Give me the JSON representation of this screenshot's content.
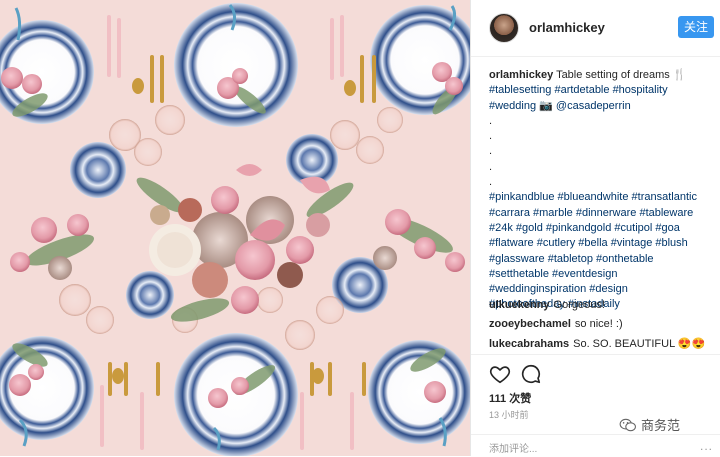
{
  "post": {
    "username": "orlamhickey",
    "follow_label": "关注"
  },
  "caption": {
    "username": "orlamhickey",
    "text": "Table setting of dreams 🍴",
    "tags_line1": [
      "#tablesetting",
      "#artdetable",
      "#hospitality"
    ],
    "tag_wedding": "#wedding",
    "camera_icon": "📷",
    "mention": "@casadeperrin",
    "dots": [
      ".",
      ".",
      ".",
      ".",
      "."
    ],
    "hashtags": [
      "#pinkandblue",
      "#blueandwhite",
      "#transatlantic",
      "#carrara",
      "#marble",
      "#dinnerware",
      "#tableware",
      "#24k",
      "#gold",
      "#pinkandgold",
      "#cutipol",
      "#goa",
      "#flatware",
      "#cutlery",
      "#bella",
      "#vintage",
      "#blush",
      "#glassware",
      "#tabletop",
      "#onthetable",
      "#setthetable",
      "#eventdesign",
      "#weddinginspiration",
      "#design",
      "#photooftheday",
      "#instadaily"
    ]
  },
  "comments": [
    {
      "user": "ulkuekenny",
      "text": "Gorgeous!"
    },
    {
      "user": "zooeybechamel",
      "text": "so nice! :)"
    },
    {
      "user": "lukecabrahams",
      "text": "So. SO. BEAUTIFUL 😍😍"
    }
  ],
  "stats": {
    "likes": "111 次赞",
    "time": "13 小时前"
  },
  "watermark": "商务范",
  "add_comment": {
    "placeholder": "添加评论...",
    "more": "..."
  },
  "colors": {
    "tablecloth": "#f4dcd8",
    "plate_blue": "#2f4f8a",
    "gold": "#c99a3d",
    "link": "#003569",
    "follow_button": "#3897f0"
  },
  "icons": {
    "like": "heart-icon",
    "comment": "comment-bubble-icon",
    "watermark": "wechat-icon"
  }
}
